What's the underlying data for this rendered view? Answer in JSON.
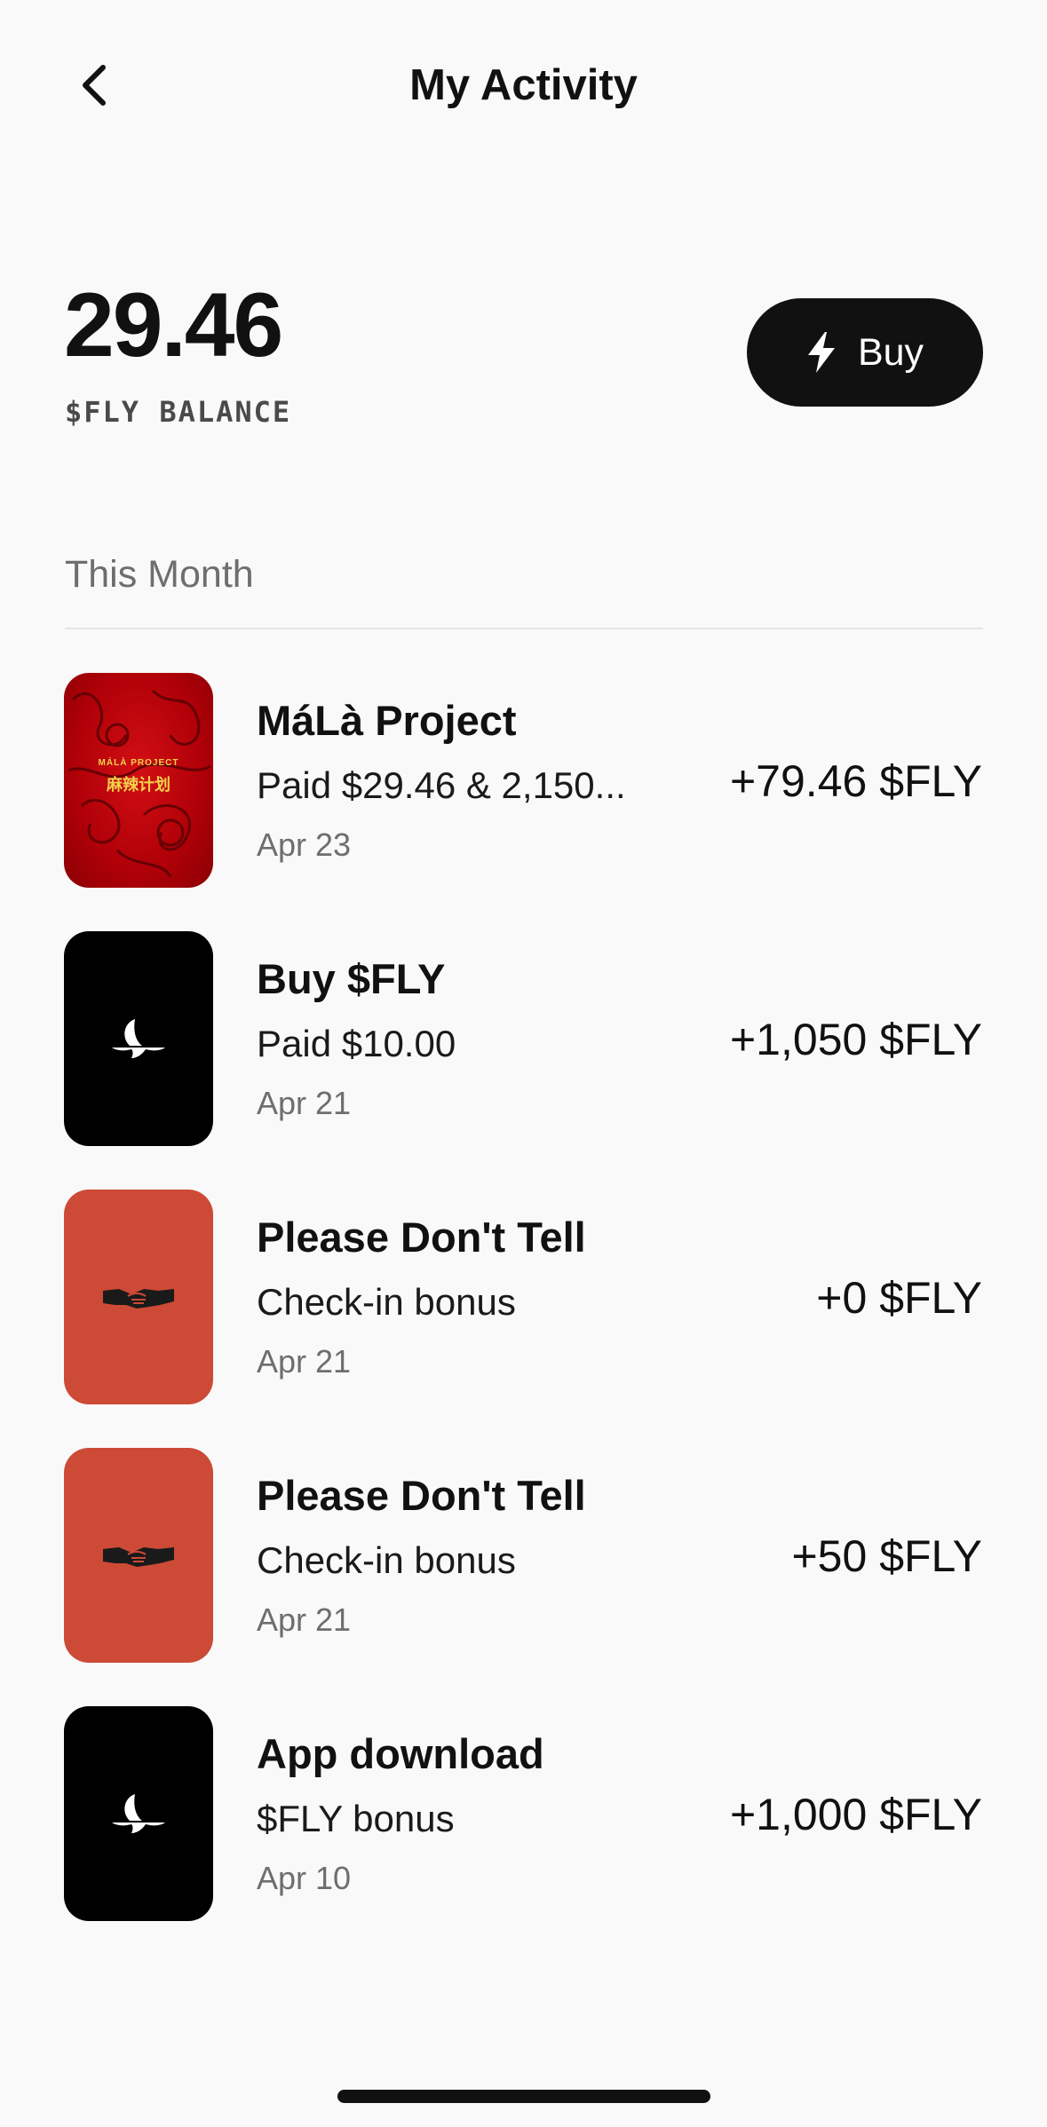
{
  "header": {
    "title": "My Activity",
    "back_icon": "chevron-left-icon"
  },
  "balance": {
    "value": "29.46",
    "label": "$FLY BALANCE"
  },
  "buy_button": {
    "label": "Buy",
    "icon": "lightning-bolt-icon"
  },
  "section": {
    "heading": "This Month"
  },
  "activities": [
    {
      "title": "MáLà Project",
      "subtitle": "Paid $29.46 & 2,150...",
      "date": "Apr 23",
      "amount": "+79.46 $FLY",
      "thumb": "mala-project-art",
      "thumb_text": "MÁLÀ PROJECT",
      "thumb_text_cn": "麻辣计划"
    },
    {
      "title": "Buy $FLY",
      "subtitle": "Paid $10.00",
      "date": "Apr 21",
      "amount": "+1,050 $FLY",
      "thumb": "fly-logo-icon"
    },
    {
      "title": "Please Don't Tell",
      "subtitle": "Check-in bonus",
      "date": "Apr 21",
      "amount": "+0 $FLY",
      "thumb": "handshake-icon"
    },
    {
      "title": "Please Don't Tell",
      "subtitle": "Check-in bonus",
      "date": "Apr 21",
      "amount": "+50 $FLY",
      "thumb": "handshake-icon"
    },
    {
      "title": "App download",
      "subtitle": "$FLY bonus",
      "date": "Apr 10",
      "amount": "+1,000 $FLY",
      "thumb": "fly-logo-icon"
    }
  ],
  "colors": {
    "background": "#f9f9f9",
    "text": "#111111",
    "muted": "#6e6e6e",
    "button": "#111111",
    "mala_red": "#c4070d",
    "pdt_orange": "#cc4a36"
  }
}
